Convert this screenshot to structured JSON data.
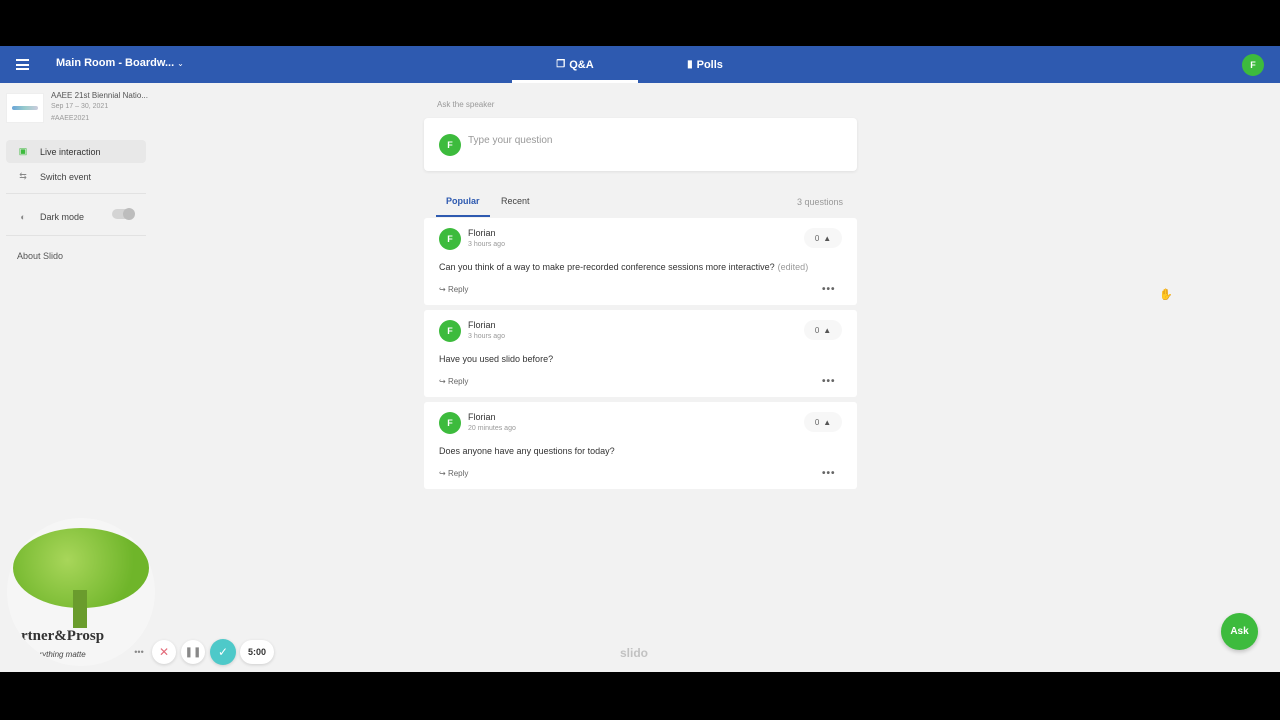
{
  "header": {
    "room_title": "Main Room - Boardw...",
    "tabs": [
      {
        "label": "Q&A",
        "icon": "chat-bubbles-icon"
      },
      {
        "label": "Polls",
        "icon": "bar-chart-icon"
      }
    ],
    "user_initial": "F"
  },
  "sidebar": {
    "event": {
      "name": "AAEE 21st Biennial Natio...",
      "date": "Sep 17 – 30, 2021",
      "hashtag": "#AAEE2021"
    },
    "items": [
      {
        "label": "Live interaction",
        "icon": "chat-icon",
        "active": true
      },
      {
        "label": "Switch event",
        "icon": "swap-icon",
        "active": false
      }
    ],
    "dark_mode_label": "Dark mode",
    "dark_mode_on": false,
    "about_label": "About Slido"
  },
  "ask": {
    "label": "Ask the speaker",
    "placeholder": "Type your question",
    "avatar_initial": "F",
    "fab_label": "Ask"
  },
  "questions_panel": {
    "tabs": [
      "Popular",
      "Recent"
    ],
    "active_tab": "Popular",
    "count_text": "3 questions",
    "questions": [
      {
        "initial": "F",
        "author": "Florian",
        "time": "3 hours ago",
        "likes": "0",
        "text": "Can you think of a way to make pre-recorded conference sessions more interactive?",
        "edited": "(edited)",
        "reply_label": "Reply"
      },
      {
        "initial": "F",
        "author": "Florian",
        "time": "3 hours ago",
        "likes": "0",
        "text": "Have you used slido before?",
        "edited": "",
        "reply_label": "Reply"
      },
      {
        "initial": "F",
        "author": "Florian",
        "time": "20 minutes ago",
        "likes": "0",
        "text": "Does anyone have any questions for today?",
        "edited": "",
        "reply_label": "Reply"
      }
    ]
  },
  "footer": {
    "watermark": "slido"
  },
  "overlay": {
    "brand_text": "rtner&Prosp",
    "brand_tagline": "erything matte",
    "timer": "5:00"
  },
  "colors": {
    "header_bg": "#2e5ab0",
    "accent_green": "#3dbb3d",
    "check_teal": "#4ec9c9"
  }
}
